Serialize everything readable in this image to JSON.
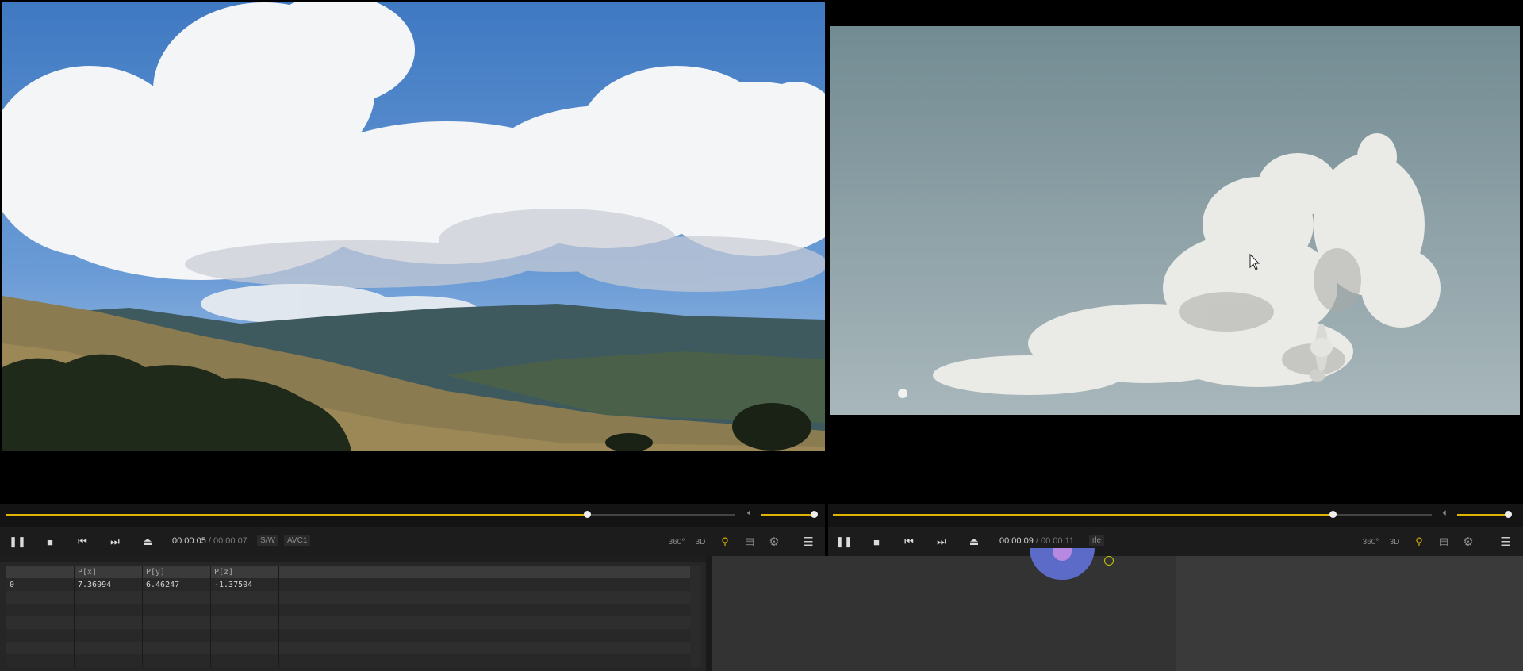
{
  "left_player": {
    "progress": 0.797,
    "volume": 1.0,
    "current_time": "00:00:05",
    "separator": "/",
    "duration": "00:00:07",
    "tags": [
      "S/W",
      "AVC1"
    ],
    "right_icons": [
      "360",
      "3D",
      "search-list",
      "subtitle",
      "settings",
      "menu"
    ]
  },
  "right_player": {
    "progress": 0.834,
    "volume": 1.0,
    "current_time": "00:00:09",
    "separator": "/",
    "duration": "00:00:11",
    "tags": [
      "rle"
    ],
    "right_icons": [
      "360",
      "3D",
      "search-list",
      "subtitle",
      "settings",
      "menu"
    ]
  },
  "icon_labels": {
    "360": "360°",
    "3d": "3D"
  },
  "spreadsheet": {
    "columns": [
      "",
      "P[x]",
      "P[y]",
      "P[z]",
      ""
    ],
    "rows": [
      [
        "0",
        "7.36994",
        "6.46247",
        "-1.37504",
        ""
      ]
    ]
  },
  "colors": {
    "accent": "#e0b400",
    "panel": "#1e1e1e",
    "node": "#5b6bc7"
  }
}
